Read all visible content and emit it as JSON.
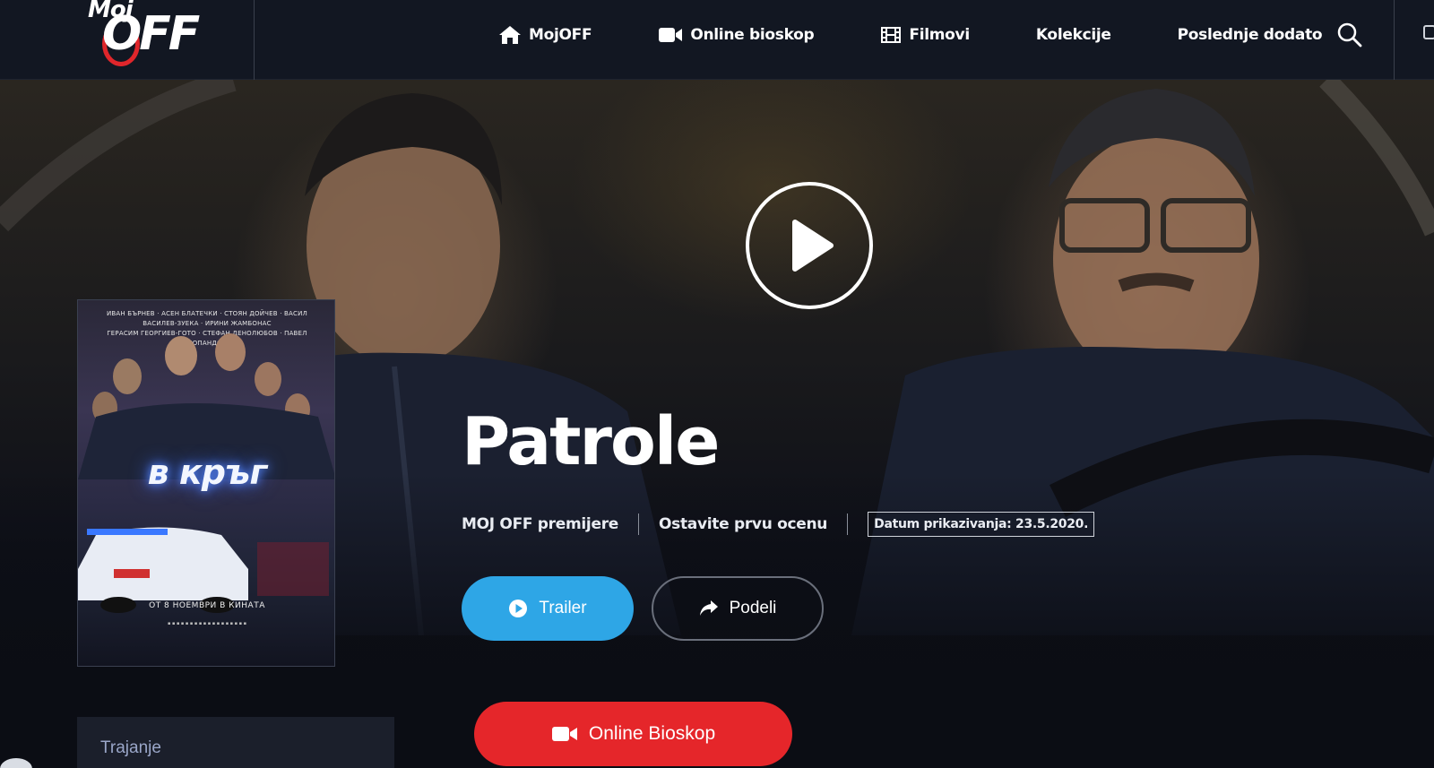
{
  "header": {
    "logo_top": "Moj",
    "logo_main": "OFF",
    "nav": [
      {
        "label": "MojOFF",
        "icon": "home-icon"
      },
      {
        "label": "Online bioskop",
        "icon": "video-camera-icon"
      },
      {
        "label": "Filmovi",
        "icon": "film-icon"
      },
      {
        "label": "Kolekcije",
        "icon": ""
      },
      {
        "label": "Poslednje dodato",
        "icon": ""
      }
    ],
    "search_icon": "search-icon"
  },
  "poster": {
    "credits_line1": "ИВАН БЪРНЕВ · АСЕН БЛАТЕЧКИ · СТОЯН ДОЙЧЕВ · ВАСИЛ ВАСИЛЕВ-ЗУЕКА · ИРИНИ ЖАМБОНАС",
    "credits_line2": "ГЕРАСИМ ГЕОРГИЕВ-ГОТО · СТЕФАН ДЕНОЛЮБОВ · ПАВЕЛ ПОПАНДОВ",
    "title": "в кръг",
    "date_line": "ОТ 8 НОЕМВРИ В КИНАТА"
  },
  "movie": {
    "title": "Patrole",
    "category": "MOJ OFF premijere",
    "rating_prompt": "Ostavite prvu ocenu",
    "release": "Datum prikazivanja: 23.5.2020."
  },
  "buttons": {
    "trailer": "Trailer",
    "share": "Podeli",
    "online": "Online Bioskop"
  },
  "info": {
    "duration_label": "Trajanje"
  },
  "colors": {
    "trailer_blue": "#2ea6e6",
    "online_red": "#e5262a",
    "header_bg": "#121722",
    "page_bg": "#0b0d14"
  }
}
